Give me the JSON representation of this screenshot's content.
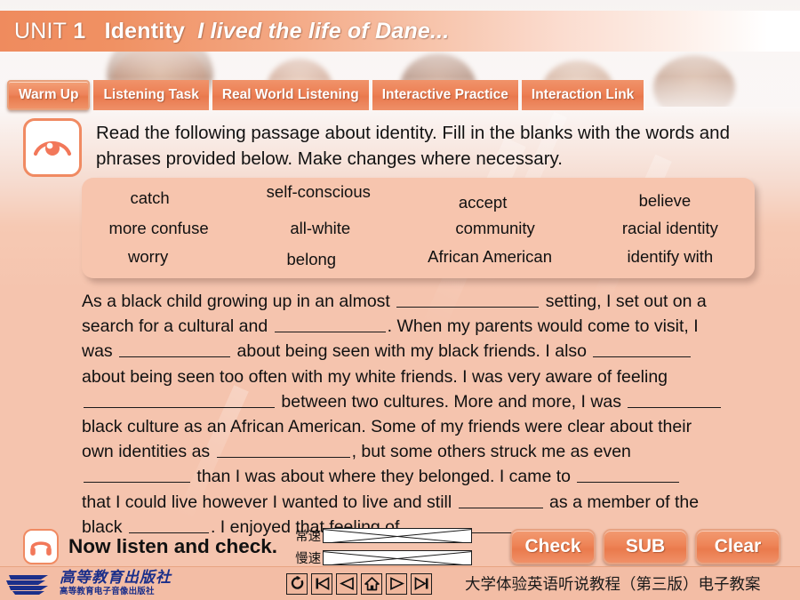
{
  "header": {
    "unit_word": "UNIT",
    "unit_number": "1",
    "identity": "Identity",
    "subtitle": "I lived the life of Dane..."
  },
  "tabs": [
    {
      "label": "Warm Up",
      "active": true
    },
    {
      "label": "Listening Task",
      "active": false
    },
    {
      "label": "Real World Listening",
      "active": false
    },
    {
      "label": "Interactive Practice",
      "active": false
    },
    {
      "label": "Interaction Link",
      "active": false
    }
  ],
  "instruction": {
    "icon": "eye-icon",
    "text": "Read the following passage about identity. Fill in the blanks with the words and phrases provided below. Make changes where necessary."
  },
  "word_bank": {
    "columns": [
      [
        "catch",
        "more confuse",
        "worry"
      ],
      [
        "self-conscious",
        "all-white",
        "belong"
      ],
      [
        "accept",
        "community",
        "African American"
      ],
      [
        "believe",
        "racial identity",
        "identify with"
      ]
    ]
  },
  "passage": {
    "lines": [
      "  As a black child growing up in an almost ___BLANK160___ setting, I set out on a",
      "search for a cultural and ___BLANK125___. When my parents would come to visit, I",
      "was ___BLANK125___ about being seen with my black friends. I also ___BLANK110___",
      "about being seen too often with my white friends. I was very aware of feeling",
      "___BLANK215___ between two cultures. More and more, I was ___BLANK105___",
      "black culture as an African American. Some of my friends were clear about their",
      "own identities as ___BLANK150___, but some others struck me as even",
      "___BLANK120___ than I was about where they belonged. I came to ___BLANK115___",
      "that I could live however I wanted to live and still ___BLANK95___ as a member of the",
      "black ___BLANK90___. I enjoyed that feeling of ___BLANK140___."
    ],
    "full_text": "As a black child growing up in an almost ________ setting, I set out on a search for a cultural and ________. When my parents would come to visit, I was ________ about being seen with my black friends. I also ________ about being seen too often with my white friends. I was very aware of feeling ________ between two cultures. More and more, I was ________ black culture as an African American. Some of my friends were clear about their own identities as ________, but some others struck me as even ________ than I was about where they belonged. I came to ________ that I could live however I wanted to live and still ________ as a member of the black ________. I enjoyed that feeling of ________."
  },
  "listen": {
    "icon": "headphone-icon",
    "label": "Now listen and check.",
    "speed_rows": [
      {
        "label": "常速",
        "value": ""
      },
      {
        "label": "慢速",
        "value": ""
      }
    ]
  },
  "actions": [
    {
      "label": "Check"
    },
    {
      "label": "SUB"
    },
    {
      "label": "Clear"
    }
  ],
  "footer": {
    "logo_main": "高等教育出版社",
    "logo_sub": "高等教育电子音像出版社",
    "nav_buttons": [
      {
        "icon": "refresh-icon",
        "name": "replay"
      },
      {
        "icon": "skip-back-icon",
        "name": "first"
      },
      {
        "icon": "triangle-left-icon",
        "name": "previous"
      },
      {
        "icon": "home-icon",
        "name": "home"
      },
      {
        "icon": "triangle-right-icon",
        "name": "next"
      },
      {
        "icon": "skip-forward-icon",
        "name": "last"
      }
    ],
    "title": "大学体验英语听说教程（第三版）电子教案"
  },
  "colors": {
    "accent": "#ee8457",
    "header_start": "#ef8b5e",
    "panel": "#f7c5ae",
    "body_bg": "#f5c4ae",
    "footer_bg": "#f3bda5",
    "logo_blue": "#1b2f8a"
  }
}
